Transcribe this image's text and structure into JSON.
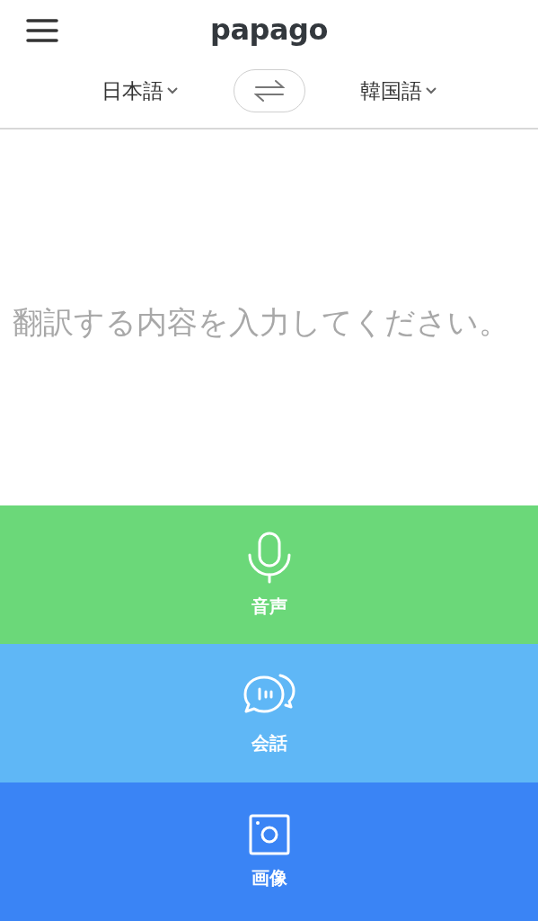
{
  "header": {
    "logo": "papago"
  },
  "languages": {
    "source": "日本語",
    "target": "韓国語"
  },
  "input": {
    "placeholder": "翻訳する内容を入力してください。"
  },
  "modes": [
    {
      "kind": "voice",
      "label": "音声",
      "color": "#6bd879"
    },
    {
      "kind": "conversation",
      "label": "会話",
      "color": "#5fb7f6"
    },
    {
      "kind": "image",
      "label": "画像",
      "color": "#3a84f5"
    }
  ]
}
